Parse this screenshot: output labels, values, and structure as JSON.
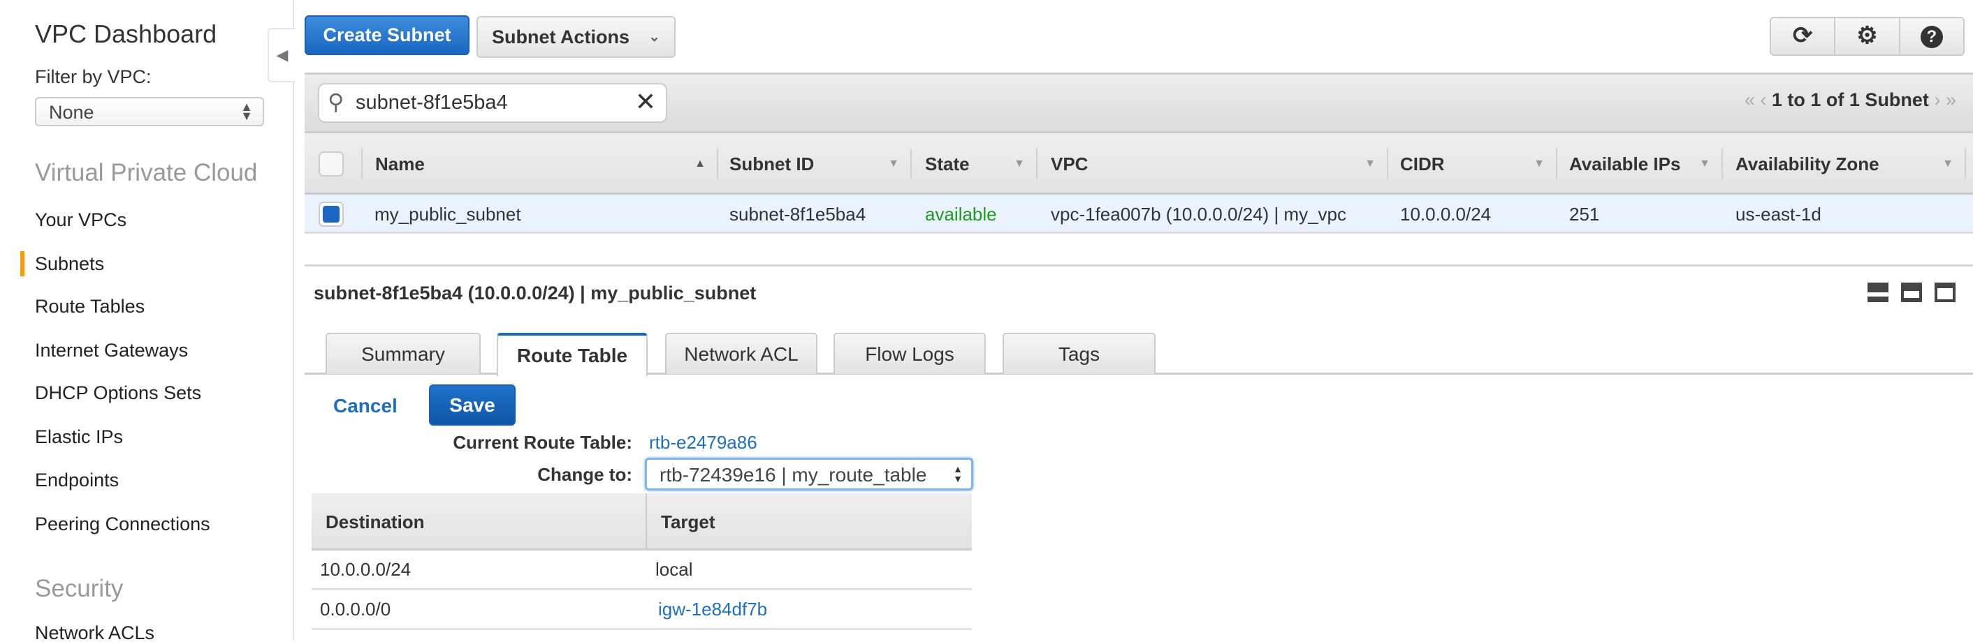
{
  "sidebar": {
    "title": "VPC Dashboard",
    "filter_label": "Filter by VPC:",
    "filter_value": "None",
    "section_vpc": "Virtual Private Cloud",
    "items": [
      "Your VPCs",
      "Subnets",
      "Route Tables",
      "Internet Gateways",
      "DHCP Options Sets",
      "Elastic IPs",
      "Endpoints",
      "Peering Connections"
    ],
    "active_item": "Subnets",
    "section_security": "Security",
    "security_items": [
      "Network ACLs"
    ]
  },
  "toolbar": {
    "create_label": "Create Subnet",
    "actions_label": "Subnet Actions",
    "icons": [
      "refresh-icon",
      "gear-icon",
      "help-icon"
    ]
  },
  "search": {
    "value": "subnet-8f1e5ba4"
  },
  "pager": {
    "text": "1 to 1 of 1 Subnet"
  },
  "table": {
    "columns": [
      "Name",
      "Subnet ID",
      "State",
      "VPC",
      "CIDR",
      "Available IPs",
      "Availability Zone"
    ],
    "rows": [
      {
        "name": "my_public_subnet",
        "subnet_id": "subnet-8f1e5ba4",
        "state": "available",
        "vpc": "vpc-1fea007b (10.0.0.0/24) | my_vpc",
        "cidr": "10.0.0.0/24",
        "available_ips": "251",
        "az": "us-east-1d",
        "selected": true
      }
    ]
  },
  "colors": {
    "primary": "#1a66c2",
    "state_available": "#1e9b1e",
    "link": "#1f6fbf",
    "active_marker": "#ff9900"
  },
  "detail": {
    "title": "subnet-8f1e5ba4 (10.0.0.0/24) | my_public_subnet",
    "tabs": [
      "Summary",
      "Route Table",
      "Network ACL",
      "Flow Logs",
      "Tags"
    ],
    "active_tab": "Route Table",
    "cancel_label": "Cancel",
    "save_label": "Save",
    "current_label": "Current Route Table:",
    "current_value": "rtb-e2479a86",
    "change_label": "Change to:",
    "change_value": "rtb-72439e16 | my_route_table",
    "routes": {
      "columns": [
        "Destination",
        "Target"
      ],
      "rows": [
        {
          "destination": "10.0.0.0/24",
          "target": "local",
          "target_link": false
        },
        {
          "destination": "0.0.0.0/0",
          "target": "igw-1e84df7b",
          "target_link": true
        }
      ]
    }
  }
}
